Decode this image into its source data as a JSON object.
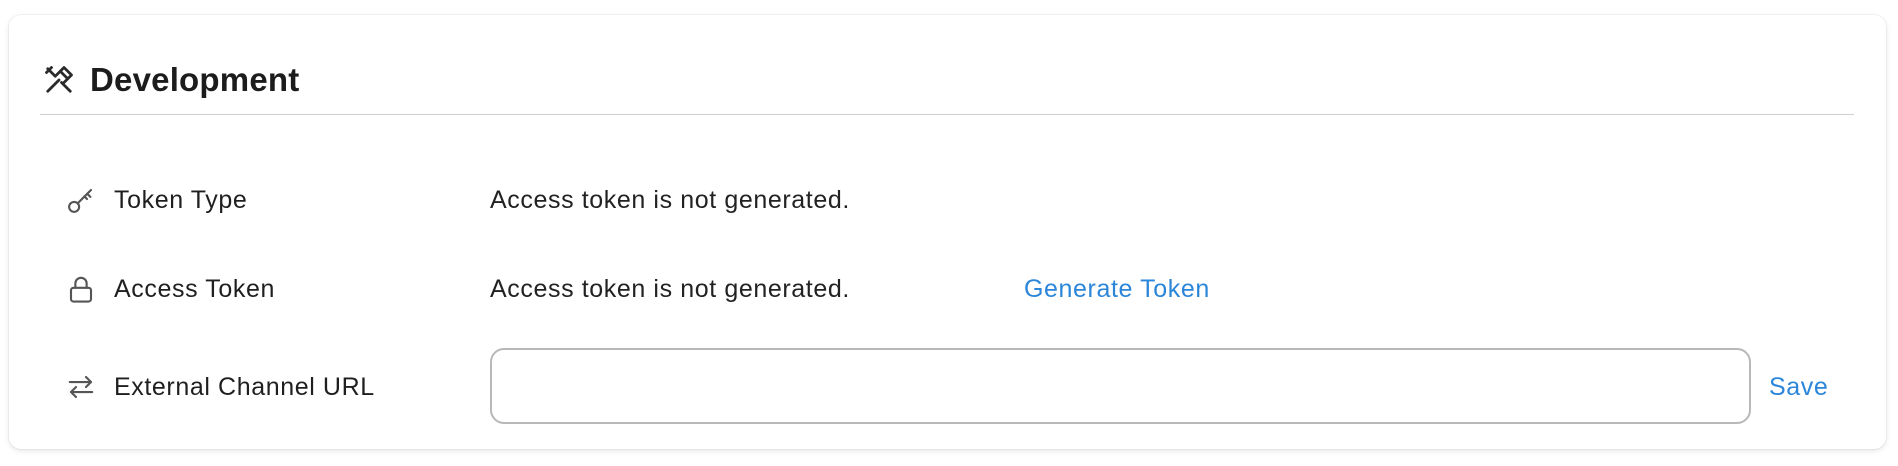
{
  "section": {
    "title": "Development",
    "icon": "tools-icon"
  },
  "rows": [
    {
      "label": "Token Type",
      "icon": "key-icon",
      "value": "Access token is not generated."
    },
    {
      "label": "Access Token",
      "icon": "lock-icon",
      "value": "Access token is not generated.",
      "action_label": "Generate Token"
    },
    {
      "label": "External Channel URL",
      "icon": "swap-arrows-icon",
      "input_value": "",
      "input_placeholder": "",
      "action_label": "Save"
    }
  ],
  "colors": {
    "link": "#2b86d9",
    "text": "#1f1f1f",
    "icon": "#555555",
    "divider": "#cfcfcf"
  }
}
